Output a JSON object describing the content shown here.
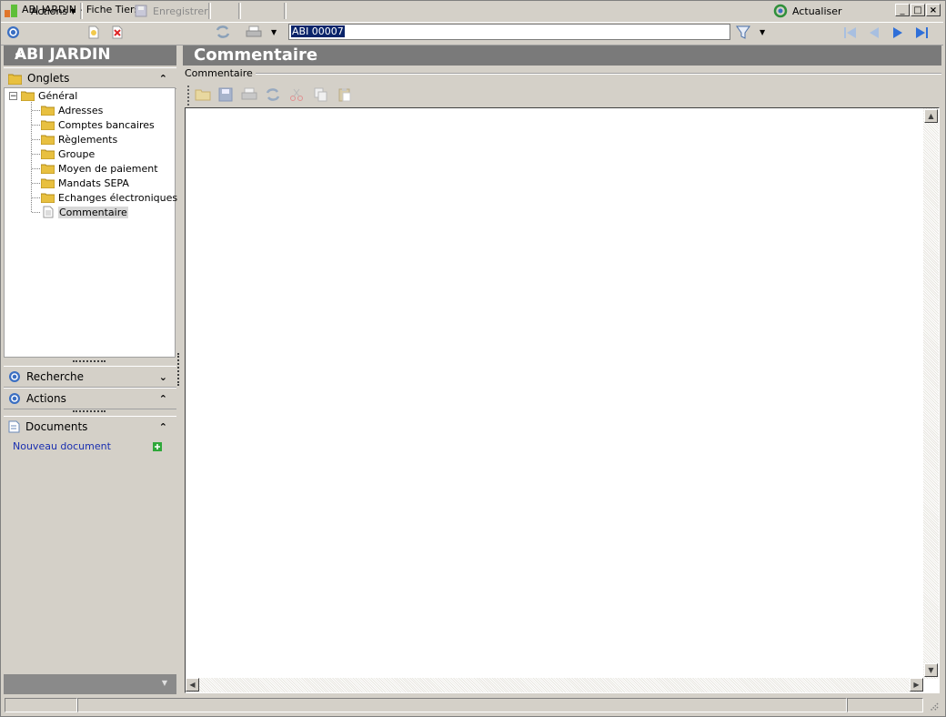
{
  "window": {
    "title": "ABI JARDIN - Fiche Tiers",
    "minimize": "_",
    "maximize": "□",
    "close": "×"
  },
  "toolbar": {
    "actions_label": "Actions",
    "save_label": "Enregistrer",
    "search_value": "ABI 00007",
    "refresh_label": "Actualiser"
  },
  "left_panel": {
    "title": "ABI JARDIN",
    "onglets_label": "Onglets",
    "tree": {
      "root": "Général",
      "children": [
        "Adresses",
        "Comptes bancaires",
        "Règlements",
        "Groupe",
        "Moyen de paiement",
        "Mandats SEPA",
        "Echanges électroniques",
        "Commentaire"
      ],
      "selected": "Commentaire"
    },
    "recherche_label": "Recherche",
    "actions_label": "Actions",
    "documents_label": "Documents",
    "new_document_label": "Nouveau document"
  },
  "main": {
    "title": "Commentaire",
    "group_label": "Commentaire",
    "editor_text": ""
  },
  "colors": {
    "header_bg": "#7a7a7a",
    "chrome_bg": "#d4d0c8",
    "link": "#1a2fb0",
    "selection": "#0a246a"
  }
}
